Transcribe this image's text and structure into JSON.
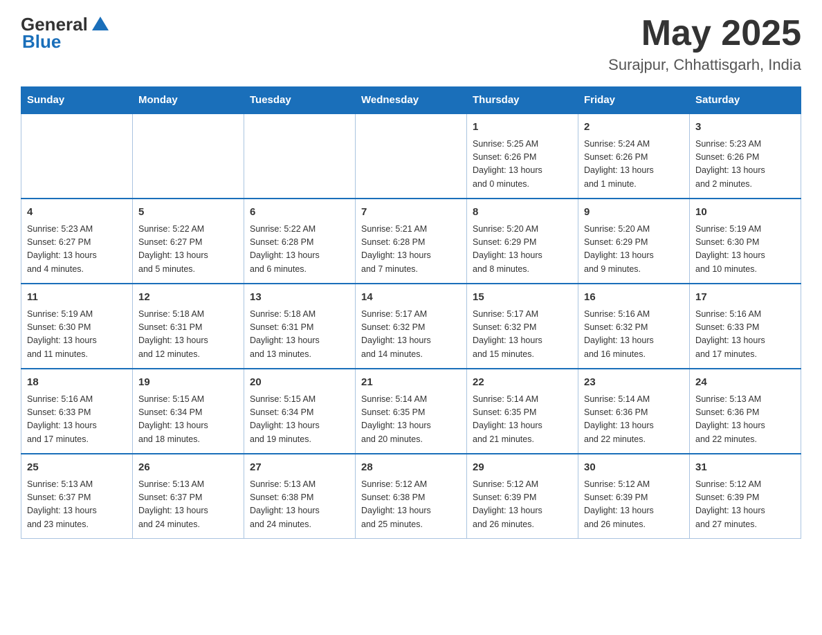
{
  "header": {
    "logo_general": "General",
    "logo_blue": "Blue",
    "month": "May 2025",
    "location": "Surajpur, Chhattisgarh, India"
  },
  "weekdays": [
    "Sunday",
    "Monday",
    "Tuesday",
    "Wednesday",
    "Thursday",
    "Friday",
    "Saturday"
  ],
  "weeks": [
    [
      {
        "day": "",
        "info": ""
      },
      {
        "day": "",
        "info": ""
      },
      {
        "day": "",
        "info": ""
      },
      {
        "day": "",
        "info": ""
      },
      {
        "day": "1",
        "info": "Sunrise: 5:25 AM\nSunset: 6:26 PM\nDaylight: 13 hours\nand 0 minutes."
      },
      {
        "day": "2",
        "info": "Sunrise: 5:24 AM\nSunset: 6:26 PM\nDaylight: 13 hours\nand 1 minute."
      },
      {
        "day": "3",
        "info": "Sunrise: 5:23 AM\nSunset: 6:26 PM\nDaylight: 13 hours\nand 2 minutes."
      }
    ],
    [
      {
        "day": "4",
        "info": "Sunrise: 5:23 AM\nSunset: 6:27 PM\nDaylight: 13 hours\nand 4 minutes."
      },
      {
        "day": "5",
        "info": "Sunrise: 5:22 AM\nSunset: 6:27 PM\nDaylight: 13 hours\nand 5 minutes."
      },
      {
        "day": "6",
        "info": "Sunrise: 5:22 AM\nSunset: 6:28 PM\nDaylight: 13 hours\nand 6 minutes."
      },
      {
        "day": "7",
        "info": "Sunrise: 5:21 AM\nSunset: 6:28 PM\nDaylight: 13 hours\nand 7 minutes."
      },
      {
        "day": "8",
        "info": "Sunrise: 5:20 AM\nSunset: 6:29 PM\nDaylight: 13 hours\nand 8 minutes."
      },
      {
        "day": "9",
        "info": "Sunrise: 5:20 AM\nSunset: 6:29 PM\nDaylight: 13 hours\nand 9 minutes."
      },
      {
        "day": "10",
        "info": "Sunrise: 5:19 AM\nSunset: 6:30 PM\nDaylight: 13 hours\nand 10 minutes."
      }
    ],
    [
      {
        "day": "11",
        "info": "Sunrise: 5:19 AM\nSunset: 6:30 PM\nDaylight: 13 hours\nand 11 minutes."
      },
      {
        "day": "12",
        "info": "Sunrise: 5:18 AM\nSunset: 6:31 PM\nDaylight: 13 hours\nand 12 minutes."
      },
      {
        "day": "13",
        "info": "Sunrise: 5:18 AM\nSunset: 6:31 PM\nDaylight: 13 hours\nand 13 minutes."
      },
      {
        "day": "14",
        "info": "Sunrise: 5:17 AM\nSunset: 6:32 PM\nDaylight: 13 hours\nand 14 minutes."
      },
      {
        "day": "15",
        "info": "Sunrise: 5:17 AM\nSunset: 6:32 PM\nDaylight: 13 hours\nand 15 minutes."
      },
      {
        "day": "16",
        "info": "Sunrise: 5:16 AM\nSunset: 6:32 PM\nDaylight: 13 hours\nand 16 minutes."
      },
      {
        "day": "17",
        "info": "Sunrise: 5:16 AM\nSunset: 6:33 PM\nDaylight: 13 hours\nand 17 minutes."
      }
    ],
    [
      {
        "day": "18",
        "info": "Sunrise: 5:16 AM\nSunset: 6:33 PM\nDaylight: 13 hours\nand 17 minutes."
      },
      {
        "day": "19",
        "info": "Sunrise: 5:15 AM\nSunset: 6:34 PM\nDaylight: 13 hours\nand 18 minutes."
      },
      {
        "day": "20",
        "info": "Sunrise: 5:15 AM\nSunset: 6:34 PM\nDaylight: 13 hours\nand 19 minutes."
      },
      {
        "day": "21",
        "info": "Sunrise: 5:14 AM\nSunset: 6:35 PM\nDaylight: 13 hours\nand 20 minutes."
      },
      {
        "day": "22",
        "info": "Sunrise: 5:14 AM\nSunset: 6:35 PM\nDaylight: 13 hours\nand 21 minutes."
      },
      {
        "day": "23",
        "info": "Sunrise: 5:14 AM\nSunset: 6:36 PM\nDaylight: 13 hours\nand 22 minutes."
      },
      {
        "day": "24",
        "info": "Sunrise: 5:13 AM\nSunset: 6:36 PM\nDaylight: 13 hours\nand 22 minutes."
      }
    ],
    [
      {
        "day": "25",
        "info": "Sunrise: 5:13 AM\nSunset: 6:37 PM\nDaylight: 13 hours\nand 23 minutes."
      },
      {
        "day": "26",
        "info": "Sunrise: 5:13 AM\nSunset: 6:37 PM\nDaylight: 13 hours\nand 24 minutes."
      },
      {
        "day": "27",
        "info": "Sunrise: 5:13 AM\nSunset: 6:38 PM\nDaylight: 13 hours\nand 24 minutes."
      },
      {
        "day": "28",
        "info": "Sunrise: 5:12 AM\nSunset: 6:38 PM\nDaylight: 13 hours\nand 25 minutes."
      },
      {
        "day": "29",
        "info": "Sunrise: 5:12 AM\nSunset: 6:39 PM\nDaylight: 13 hours\nand 26 minutes."
      },
      {
        "day": "30",
        "info": "Sunrise: 5:12 AM\nSunset: 6:39 PM\nDaylight: 13 hours\nand 26 minutes."
      },
      {
        "day": "31",
        "info": "Sunrise: 5:12 AM\nSunset: 6:39 PM\nDaylight: 13 hours\nand 27 minutes."
      }
    ]
  ]
}
